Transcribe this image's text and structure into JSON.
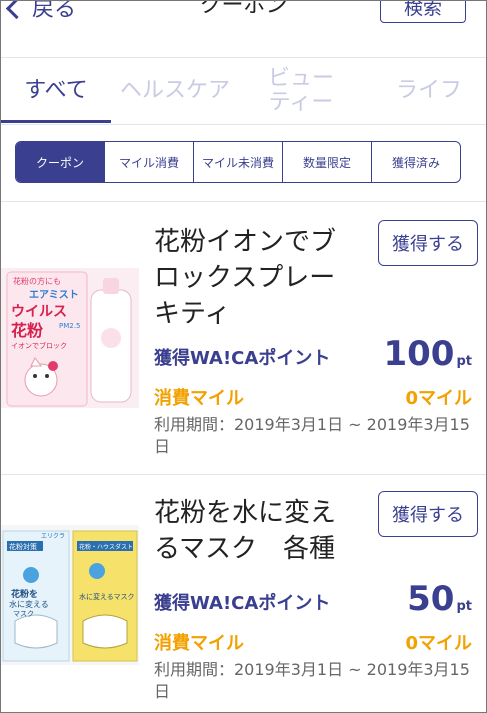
{
  "header": {
    "back_label": "戻る",
    "title": "クーポン",
    "search_label": "検索"
  },
  "tabs": [
    {
      "label": "すべて",
      "active": true
    },
    {
      "label": "ヘルスケア",
      "active": false
    },
    {
      "label": "ビューティー",
      "active": false
    },
    {
      "label": "ライフ",
      "active": false
    }
  ],
  "filters": [
    {
      "label": "クーポン",
      "active": true
    },
    {
      "label": "マイル消費",
      "active": false
    },
    {
      "label": "マイル未消費",
      "active": false
    },
    {
      "label": "数量限定",
      "active": false
    },
    {
      "label": "獲得済み",
      "active": false
    }
  ],
  "coupons": [
    {
      "title": "花粉イオンでブロックスプレーキティ",
      "get_label": "獲得する",
      "points_label": "獲得WA!CAポイント",
      "points_value": "100",
      "points_unit": "pt",
      "miles_label": "消費マイル",
      "miles_value": "0マイル",
      "period": "利用期間：2019年3月1日 ~ 2019年3月15日",
      "image": {
        "line1": "花粉の方にも",
        "brand": "エアミスト",
        "big1": "ウイルス",
        "big2": "花粉",
        "sub": "イオンでブロック",
        "badge": "PM2.5"
      }
    },
    {
      "title": "花粉を水に変えるマスク　各種",
      "get_label": "獲得する",
      "points_label": "獲得WA!CAポイント",
      "points_value": "50",
      "points_unit": "pt",
      "miles_label": "消費マイル",
      "miles_value": "0マイル",
      "period": "利用期間：2019年3月1日 ~ 2019年3月15日",
      "image": {
        "tag_left": "花粉対策",
        "text_left_1": "花粉を",
        "text_left_2": "水に変える",
        "text_left_3": "マスク",
        "tag_right": "花粉・ハウスダスト",
        "text_right": "水に変えるマスク",
        "brand": "エリクラ"
      }
    }
  ]
}
